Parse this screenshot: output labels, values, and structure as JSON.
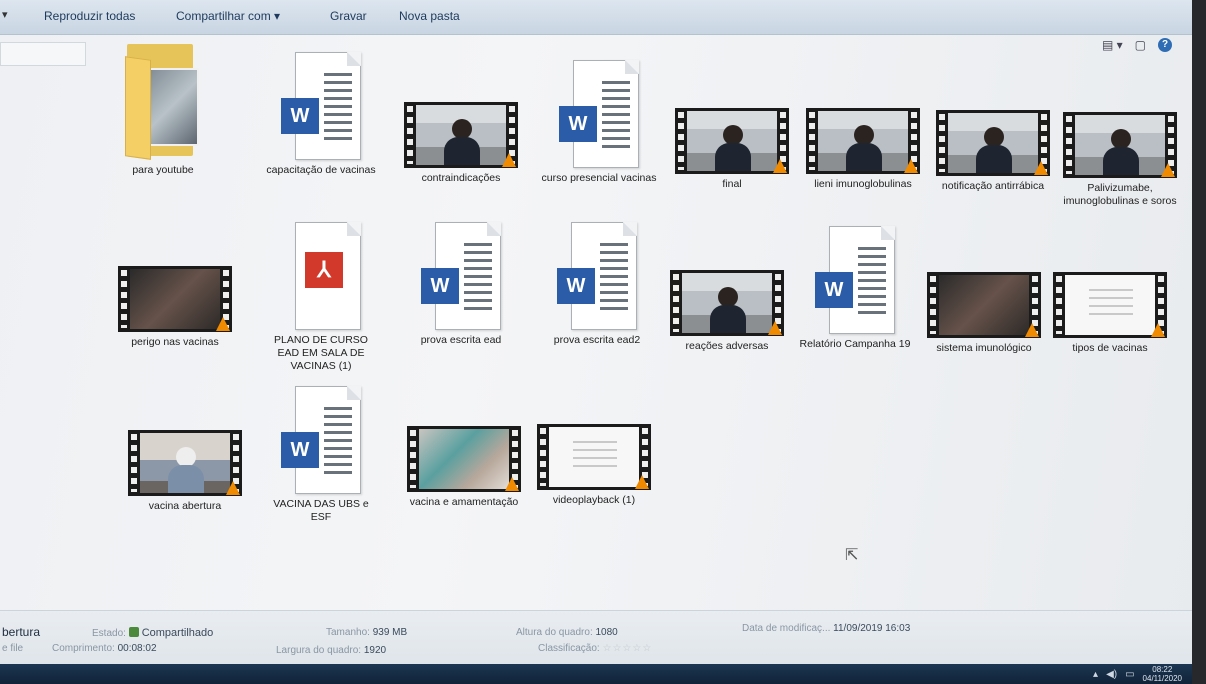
{
  "toolbar": {
    "play_all": "Reproduzir todas",
    "share_with": "Compartilhar com",
    "burn": "Gravar",
    "new_folder": "Nova pasta"
  },
  "files": [
    {
      "name": "para youtube",
      "kind": "folder"
    },
    {
      "name": "capacitação de vacinas",
      "kind": "word"
    },
    {
      "name": "contraindicações",
      "kind": "video"
    },
    {
      "name": "curso presencial vacinas",
      "kind": "word"
    },
    {
      "name": "final",
      "kind": "video"
    },
    {
      "name": "lieni imunoglobulinas",
      "kind": "video"
    },
    {
      "name": "notificação antirrábica",
      "kind": "video"
    },
    {
      "name": "Palivizumabe, imunoglobulinas e soros",
      "kind": "video"
    },
    {
      "name": "perigo nas vacinas",
      "kind": "video"
    },
    {
      "name": "PLANO DE CURSO EAD EM SALA DE VACINAS (1)",
      "kind": "pdf"
    },
    {
      "name": "prova escrita ead",
      "kind": "word"
    },
    {
      "name": "prova escrita ead2",
      "kind": "word"
    },
    {
      "name": "reações adversas",
      "kind": "video"
    },
    {
      "name": "Relatório Campanha 19",
      "kind": "word"
    },
    {
      "name": "sistema imunológico",
      "kind": "video"
    },
    {
      "name": "tipos de vacinas",
      "kind": "video"
    },
    {
      "name": "vacina abertura",
      "kind": "video"
    },
    {
      "name": "VACINA DAS UBS e ESF",
      "kind": "word"
    },
    {
      "name": "vacina e amamentação",
      "kind": "video"
    },
    {
      "name": "videoplayback (1)",
      "kind": "video"
    }
  ],
  "icons": {
    "word_badge": "W",
    "help": "?"
  },
  "details": {
    "selected_name": "bertura",
    "selected_type": "e file",
    "state_label": "Estado:",
    "state_value": "Compartilhado",
    "length_label": "Comprimento:",
    "length_value": "00:08:02",
    "size_label": "Tamanho:",
    "size_value": "939 MB",
    "frame_width_label": "Largura do quadro:",
    "frame_width_value": "1920",
    "frame_height_label": "Altura do quadro:",
    "frame_height_value": "1080",
    "rating_label": "Classificação:",
    "rating_value": 0,
    "modified_label": "Data de modificaç...",
    "modified_value": "11/09/2019 16:03"
  },
  "taskbar": {
    "time": "08:22",
    "date": "04/11/2020"
  }
}
